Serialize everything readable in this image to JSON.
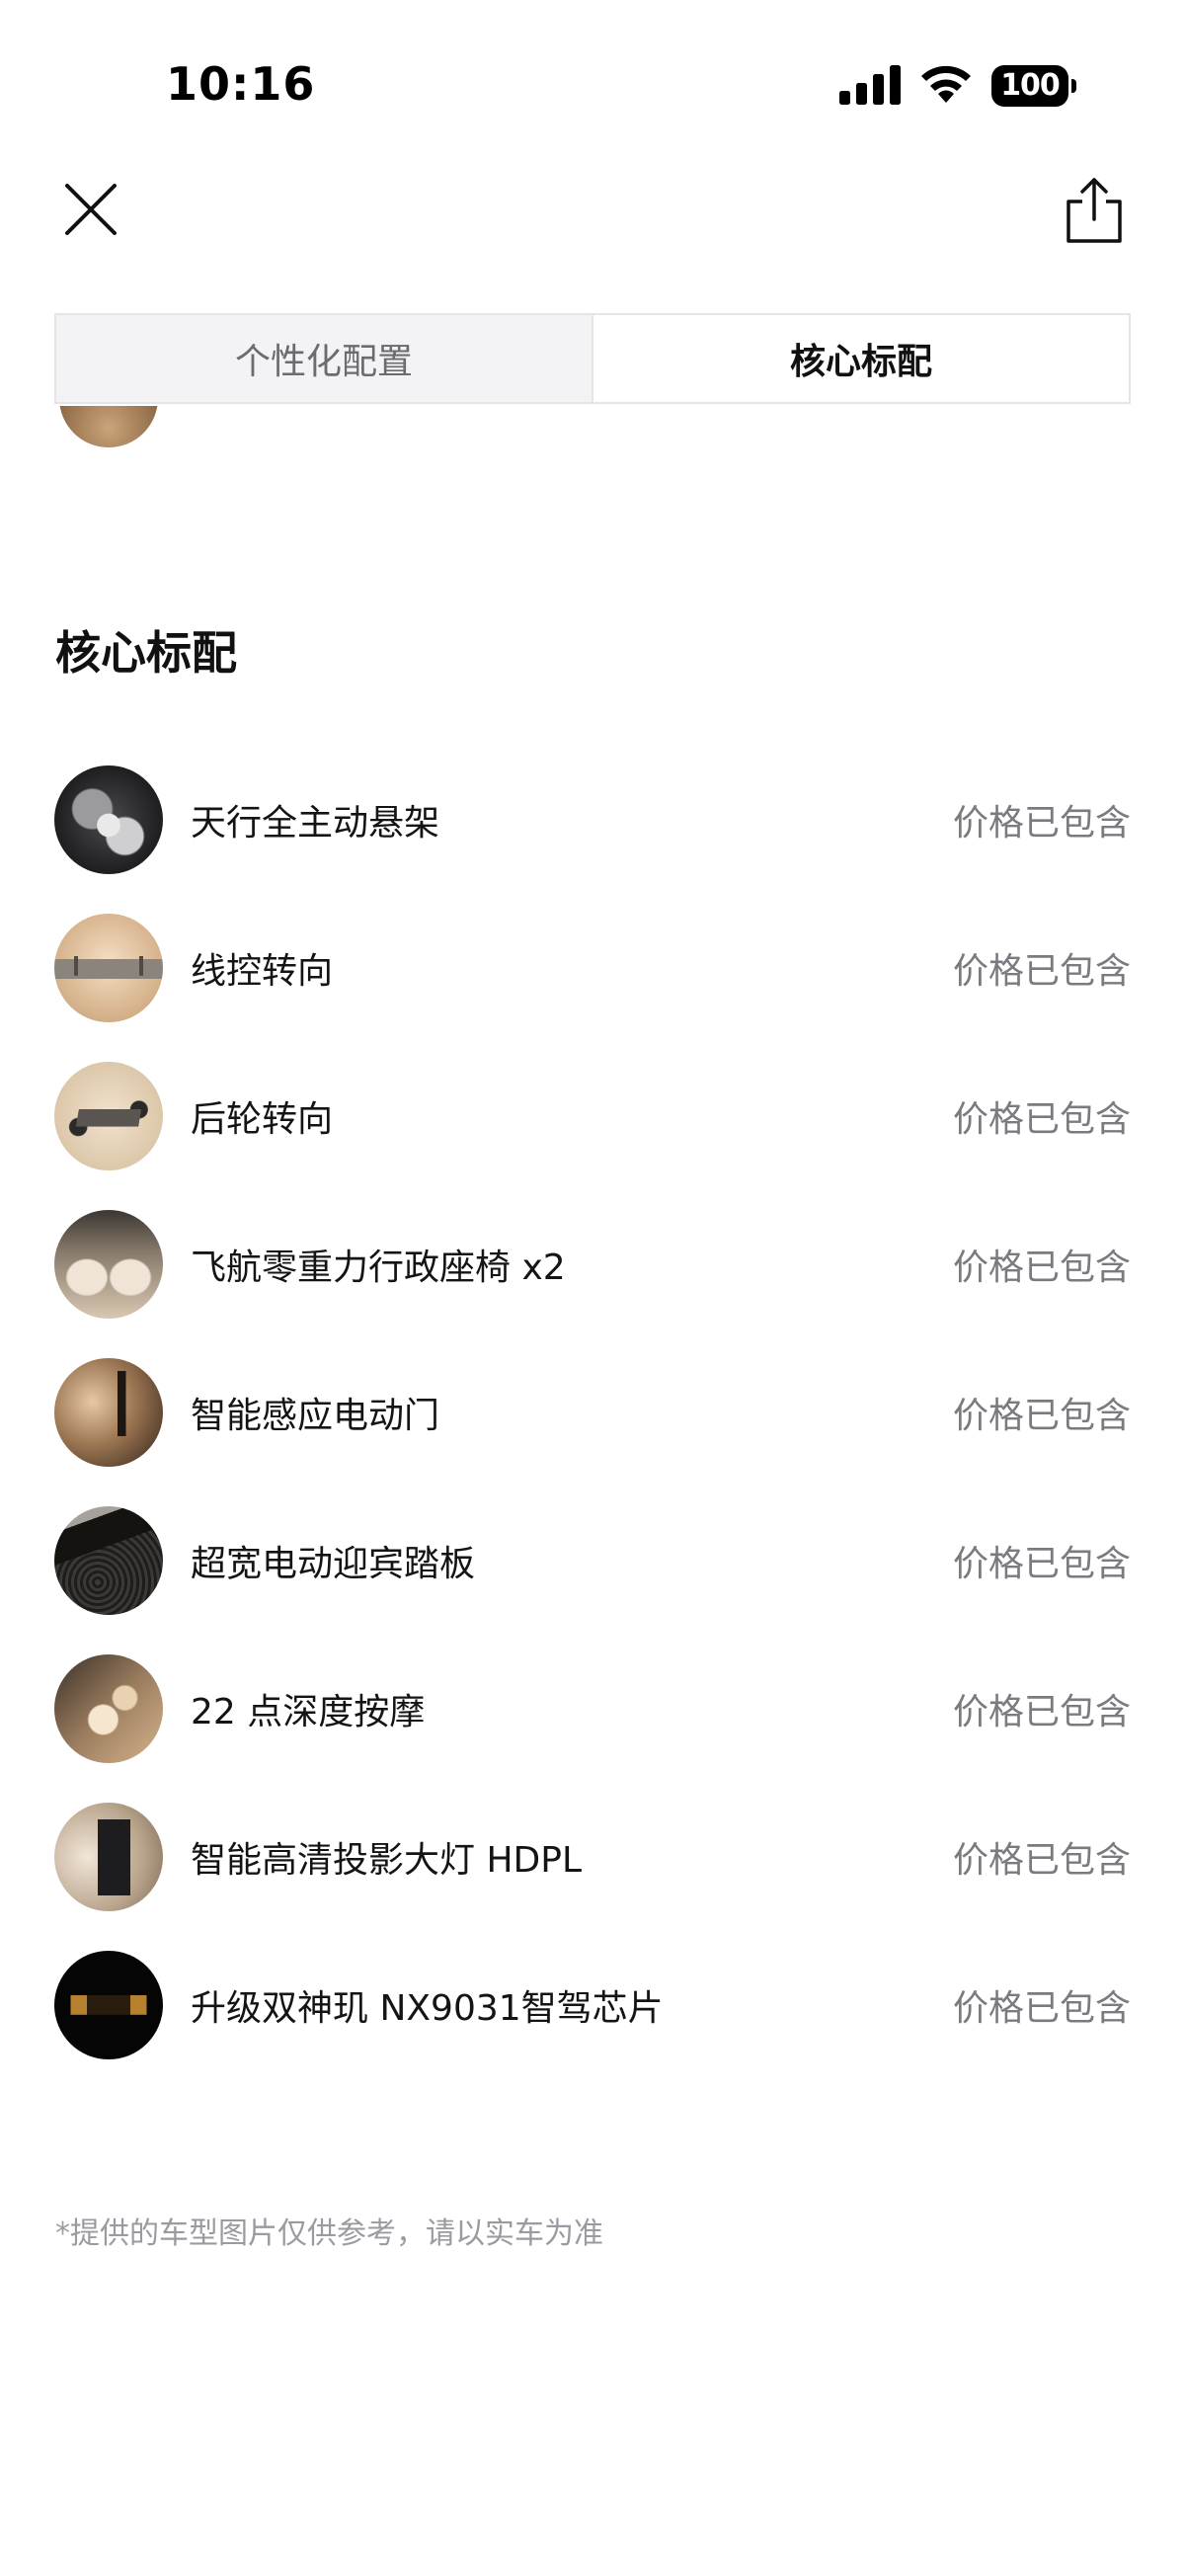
{
  "status_bar": {
    "time": "10:16",
    "battery": "100",
    "icons": [
      "signal-icon",
      "wifi-icon",
      "battery-icon"
    ]
  },
  "nav": {
    "close_icon": "close-icon",
    "share_icon": "share-icon"
  },
  "tabs": [
    {
      "label": "个性化配置",
      "active": false
    },
    {
      "label": "核心标配",
      "active": true
    }
  ],
  "section": {
    "title": "核心标配",
    "items": [
      {
        "name": "天行全主动悬架",
        "price": "价格已包含"
      },
      {
        "name": "线控转向",
        "price": "价格已包含"
      },
      {
        "name": "后轮转向",
        "price": "价格已包含"
      },
      {
        "name": "飞航零重力行政座椅 x2",
        "price": "价格已包含"
      },
      {
        "name": "智能感应电动门",
        "price": "价格已包含"
      },
      {
        "name": "超宽电动迎宾踏板",
        "price": "价格已包含"
      },
      {
        "name": "22 点深度按摩",
        "price": "价格已包含"
      },
      {
        "name": "智能高清投影大灯 HDPL",
        "price": "价格已包含"
      },
      {
        "name": "升级双神玑 NX9031智驾芯片",
        "price": "价格已包含"
      }
    ]
  },
  "disclaimer": "*提供的车型图片仅供参考，请以实车为准"
}
